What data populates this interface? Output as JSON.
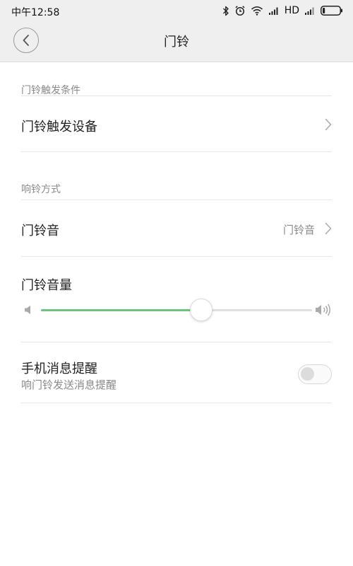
{
  "status_bar": {
    "time": "中午12:58",
    "network_label": "HD",
    "icons": [
      "bluetooth-icon",
      "alarm-icon",
      "wifi-icon",
      "signal-icon",
      "signal-icon",
      "battery-icon"
    ]
  },
  "header": {
    "title": "门铃",
    "back_icon": "chevron-left-icon"
  },
  "sections": {
    "trigger": {
      "label": "门铃触发条件",
      "device_row": {
        "title": "门铃触发设备",
        "icon": "chevron-right-icon"
      }
    },
    "ring_mode": {
      "label": "响铃方式",
      "sound_row": {
        "title": "门铃音",
        "value": "门铃音",
        "icon": "chevron-right-icon"
      },
      "volume_row": {
        "title": "门铃音量",
        "level": 0.59,
        "min_icon": "volume-low-icon",
        "max_icon": "volume-high-icon"
      }
    },
    "notification": {
      "title": "手机消息提醒",
      "subtitle": "响门铃发送消息提醒",
      "enabled": false
    }
  },
  "colors": {
    "accent": "#6cc57a",
    "header_bg": "#efefef",
    "secondary_text": "#8a8a8a"
  }
}
